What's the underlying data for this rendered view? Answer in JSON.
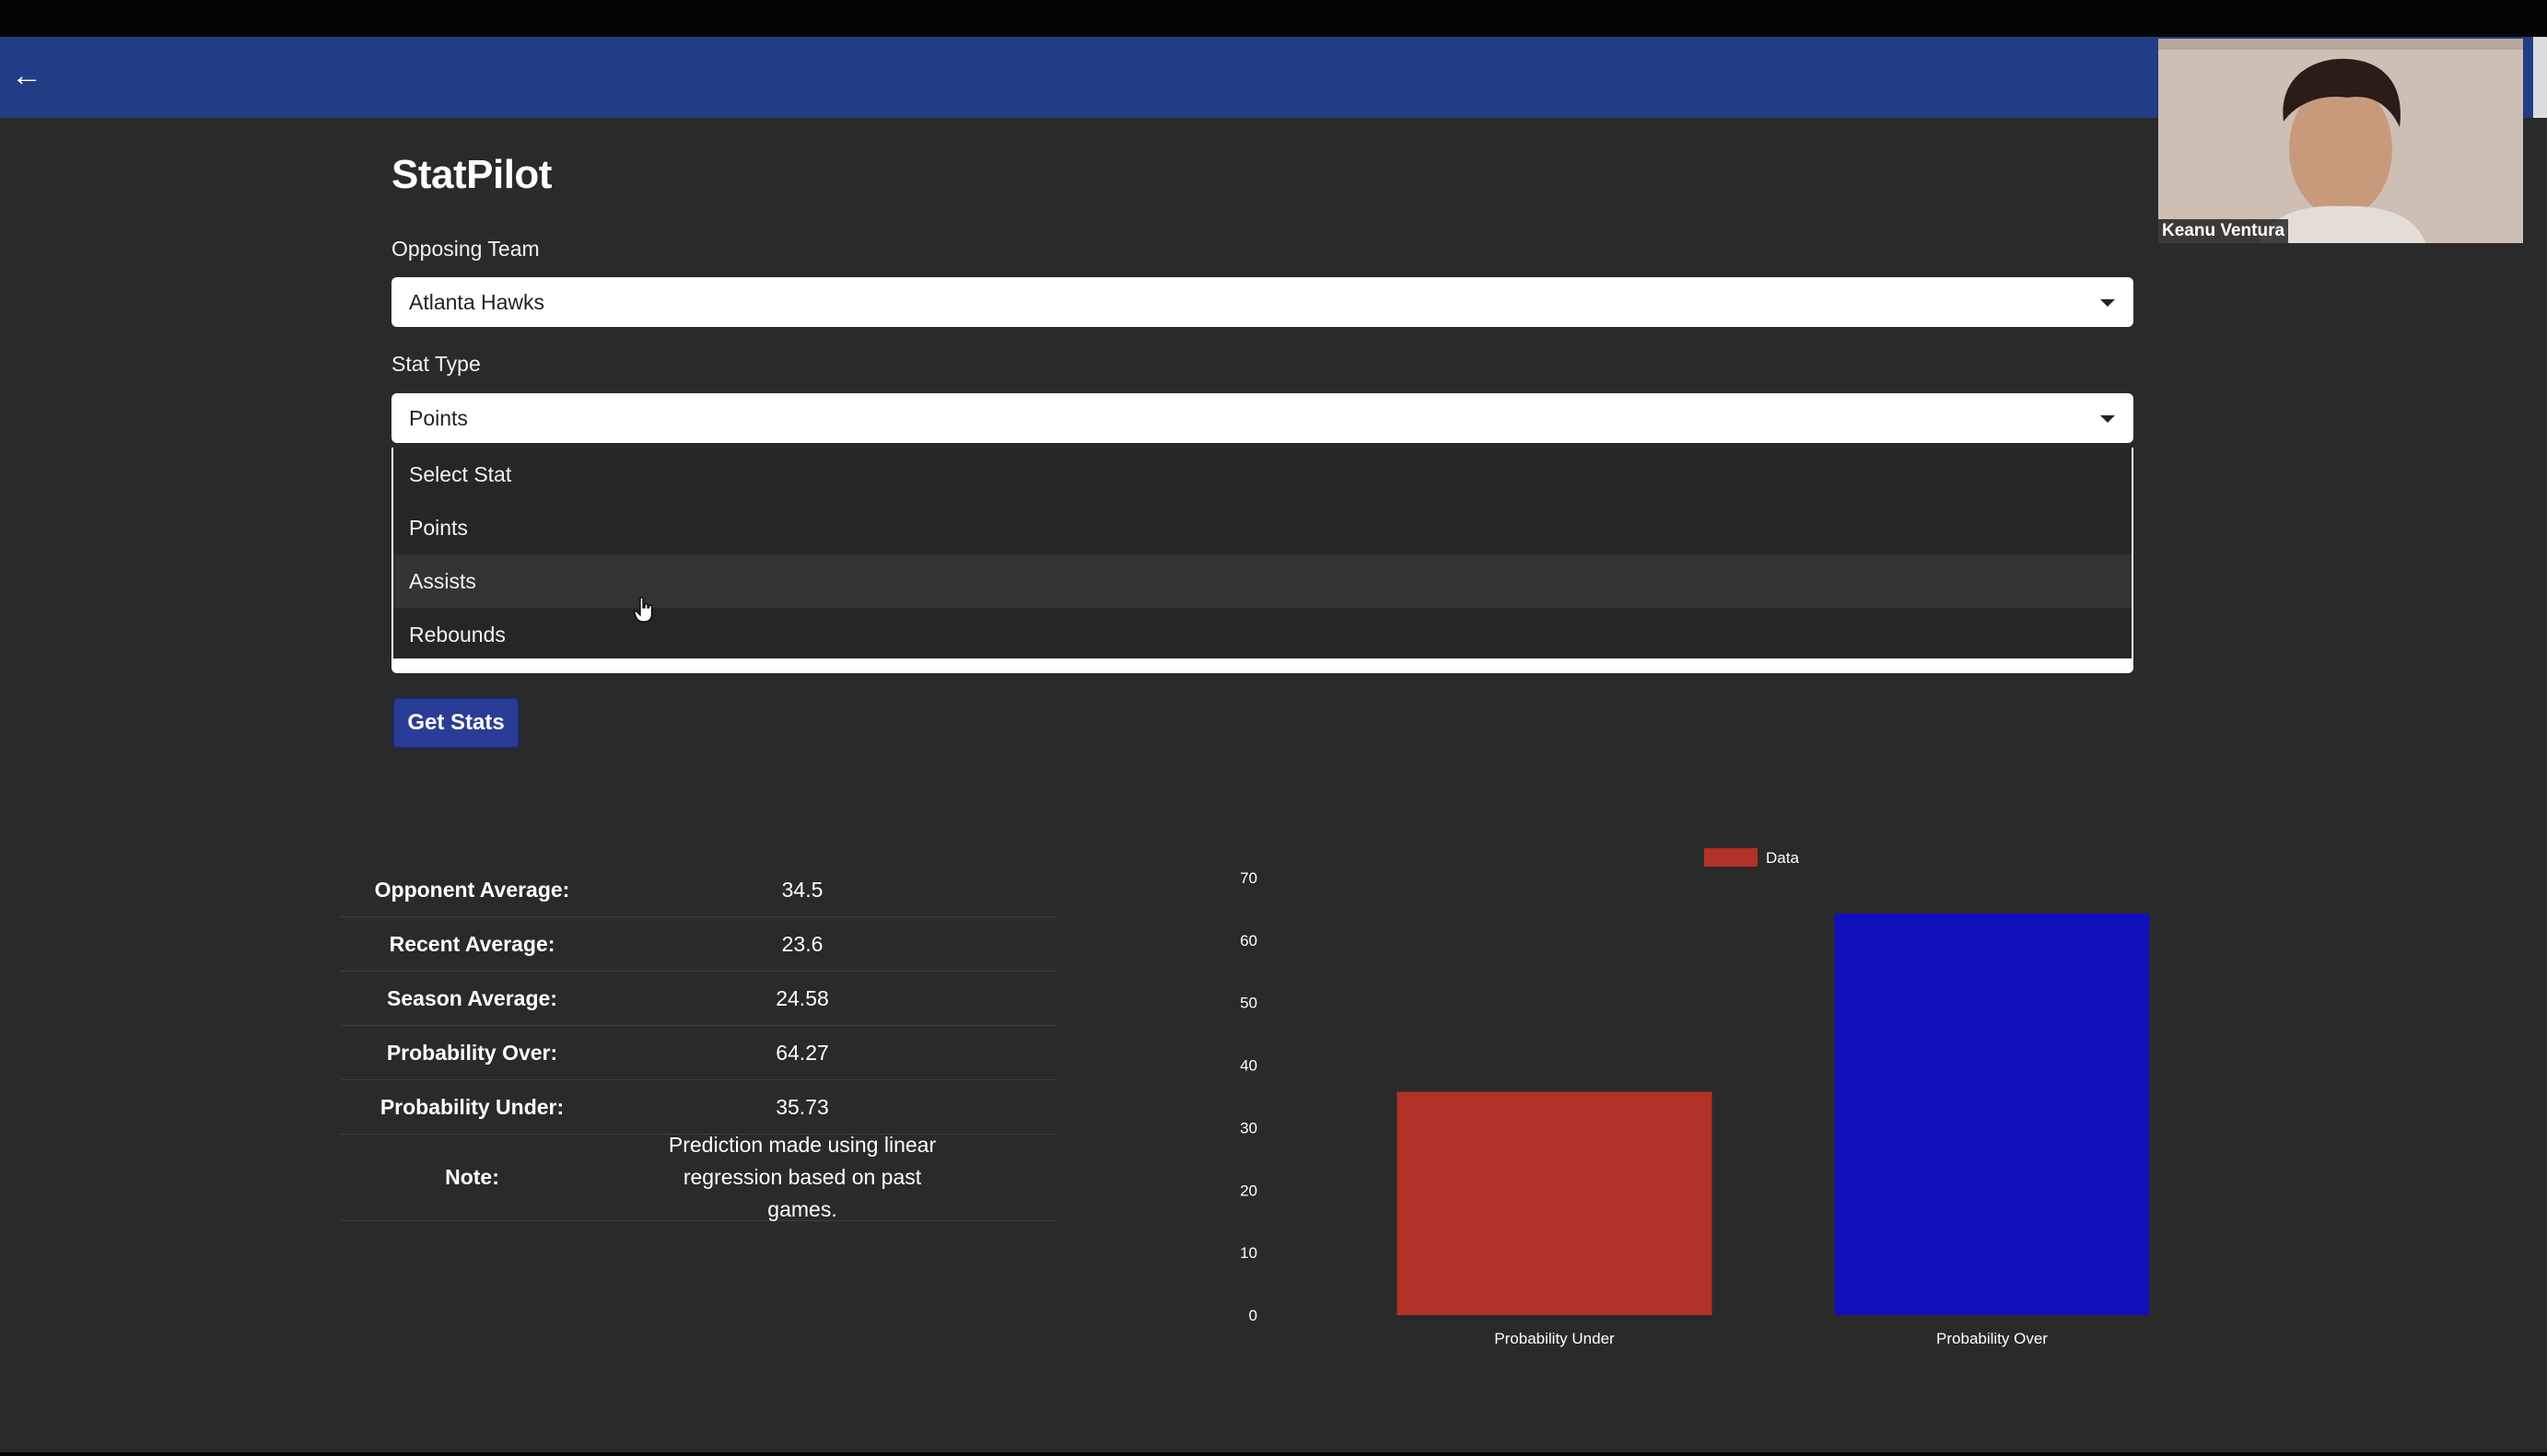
{
  "app": {
    "title": "StatPilot"
  },
  "form": {
    "team_label": "Opposing Team",
    "team_value": "Atlanta Hawks",
    "stat_label": "Stat Type",
    "stat_value": "Points",
    "stat_options": [
      "Select Stat",
      "Points",
      "Assists",
      "Rebounds"
    ],
    "hovered_option": "Assists",
    "submit_label": "Get Stats"
  },
  "stats": [
    {
      "label": "Opponent Average:",
      "value": "34.5"
    },
    {
      "label": "Recent Average:",
      "value": "23.6"
    },
    {
      "label": "Season Average:",
      "value": "24.58"
    },
    {
      "label": "Probability Over:",
      "value": "64.27"
    },
    {
      "label": "Probability Under:",
      "value": "35.73"
    },
    {
      "label": "Note:",
      "value": "Prediction made using linear regression based on past games."
    }
  ],
  "video": {
    "participant_name": "Keanu Ventura"
  },
  "icons": {
    "back": "arrow-left-icon",
    "select_caret": "caret-down-icon",
    "pointer": "hand-cursor-icon"
  },
  "colors": {
    "navbar": "#223d85",
    "button": "#2a3d96",
    "bar_under": "#b23228",
    "bar_over": "#1010bb"
  },
  "chart_data": {
    "type": "bar",
    "categories": [
      "Probability Under",
      "Probability Over"
    ],
    "series": [
      {
        "name": "Data",
        "values": [
          35.73,
          64.27
        ]
      }
    ],
    "bar_colors": [
      "#b23228",
      "#1010bb"
    ],
    "ylim": [
      0,
      70
    ],
    "yticks": [
      0,
      10,
      20,
      30,
      40,
      50,
      60,
      70
    ],
    "legend": "top-center",
    "grid": false
  }
}
